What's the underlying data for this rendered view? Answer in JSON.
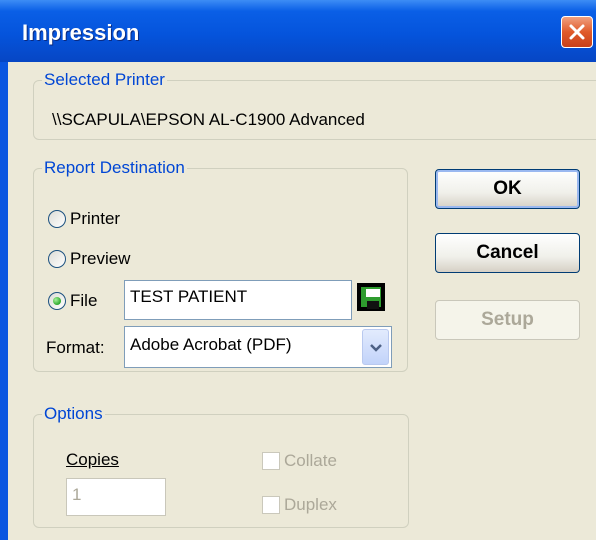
{
  "window": {
    "title": "Impression"
  },
  "selected_printer": {
    "legend": "Selected Printer",
    "name": "\\\\SCAPULA\\EPSON AL-C1900 Advanced"
  },
  "destination": {
    "legend": "Report Destination",
    "options": [
      {
        "label": "Printer",
        "checked": false
      },
      {
        "label": "Preview",
        "checked": false
      },
      {
        "label": "File",
        "checked": true
      }
    ],
    "file_value": "TEST PATIENT",
    "format_label": "Format:",
    "format_value": "Adobe Acrobat (PDF)"
  },
  "buttons": {
    "ok": "OK",
    "cancel": "Cancel",
    "setup": "Setup"
  },
  "options": {
    "legend": "Options",
    "copies_label": "Copies",
    "copies_value": "1",
    "collate_label": "Collate",
    "duplex_label": "Duplex"
  },
  "colors": {
    "title_bar": "#0a5fe6",
    "legend_text": "#0046d5",
    "dialog_bg": "#ece9d8"
  },
  "icons": {
    "close": "close-icon",
    "save": "floppy-disk-icon",
    "dropdown": "chevron-down-icon"
  }
}
